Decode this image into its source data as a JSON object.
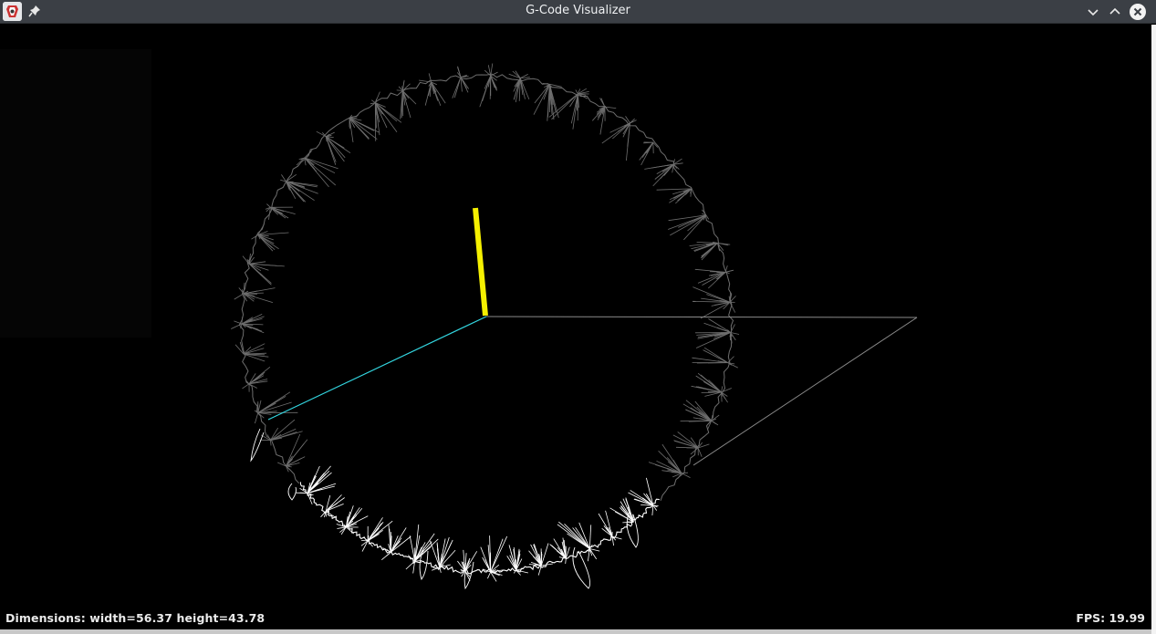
{
  "window": {
    "title": "G-Code Visualizer",
    "icons": {
      "app": "java-app-icon",
      "pin": "pin-icon",
      "minimize": "chevron-down-icon",
      "maximize": "chevron-up-icon",
      "close": "close-icon"
    }
  },
  "visualizer": {
    "colors": {
      "background": "#000000",
      "toolpath_remaining": "#6e6e6e",
      "toolpath_done": "#ffffff",
      "axis_x": "#8a8a8a",
      "axis_y": "#33d6e0",
      "axis_z": "#f5f000"
    }
  },
  "status": {
    "dimensions": "Dimensions: width=56.37 height=43.78",
    "fps": "FPS: 19.99"
  }
}
